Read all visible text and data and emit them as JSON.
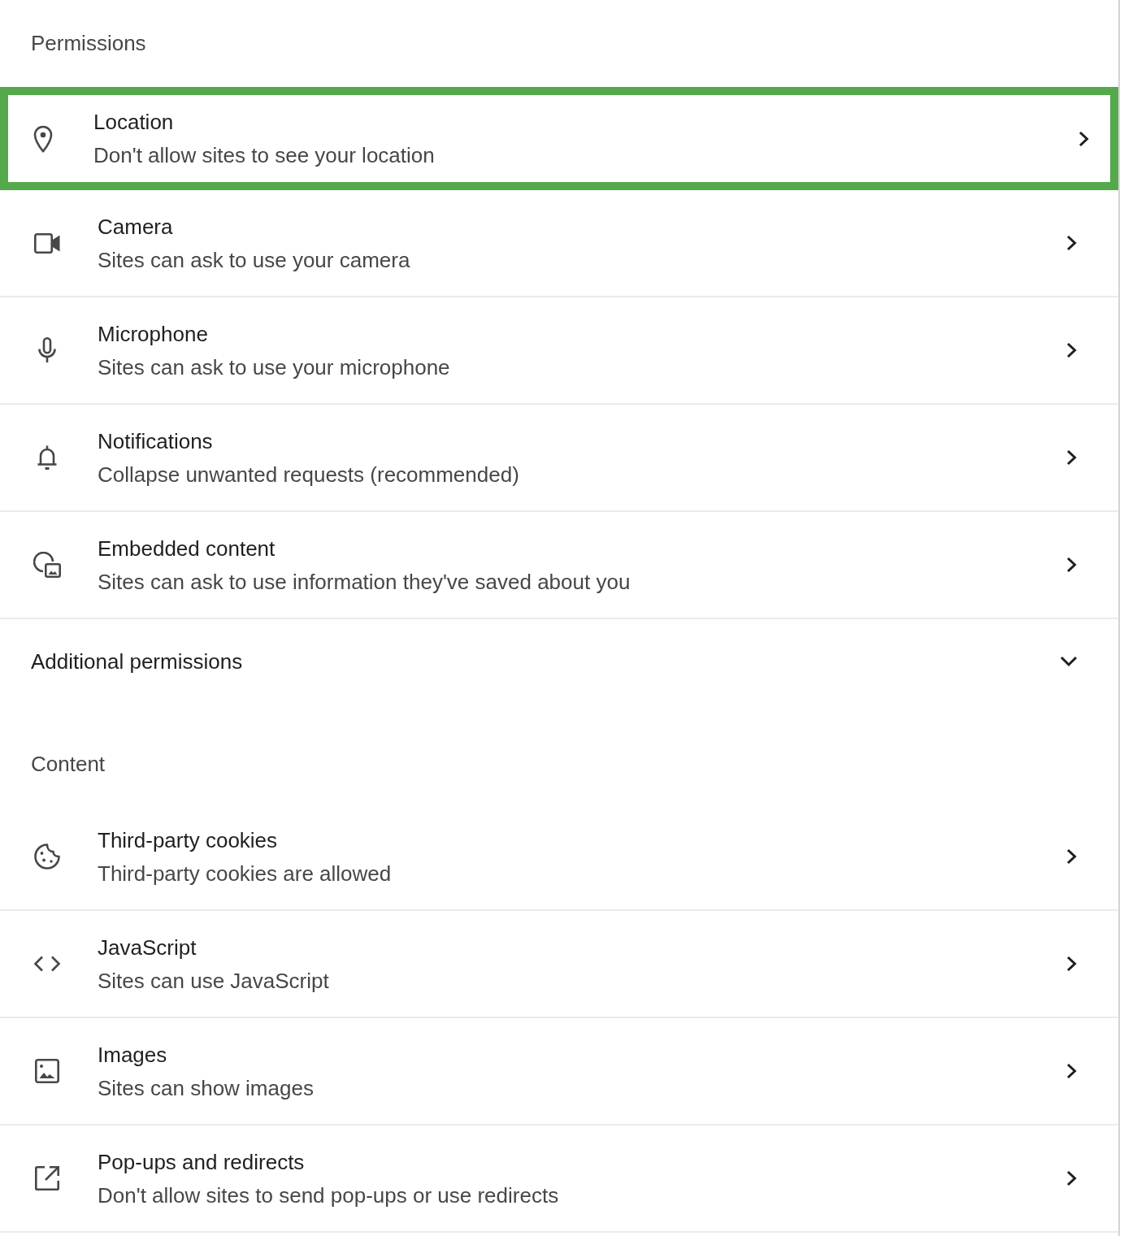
{
  "permissions": {
    "heading": "Permissions",
    "items": [
      {
        "title": "Location",
        "subtitle": "Don't allow sites to see your location",
        "highlighted": true
      },
      {
        "title": "Camera",
        "subtitle": "Sites can ask to use your camera",
        "highlighted": false
      },
      {
        "title": "Microphone",
        "subtitle": "Sites can ask to use your microphone",
        "highlighted": false
      },
      {
        "title": "Notifications",
        "subtitle": "Collapse unwanted requests (recommended)",
        "highlighted": false
      },
      {
        "title": "Embedded content",
        "subtitle": "Sites can ask to use information they've saved about you",
        "highlighted": false
      }
    ]
  },
  "additional_permissions": {
    "label": "Additional permissions",
    "expanded": false
  },
  "content": {
    "heading": "Content",
    "items": [
      {
        "title": "Third-party cookies",
        "subtitle": "Third-party cookies are allowed",
        "highlighted": false
      },
      {
        "title": "JavaScript",
        "subtitle": "Sites can use JavaScript",
        "highlighted": false
      },
      {
        "title": "Images",
        "subtitle": "Sites can show images",
        "highlighted": false
      },
      {
        "title": "Pop-ups and redirects",
        "subtitle": "Don't allow sites to send pop-ups or use redirects",
        "highlighted": false
      }
    ]
  }
}
